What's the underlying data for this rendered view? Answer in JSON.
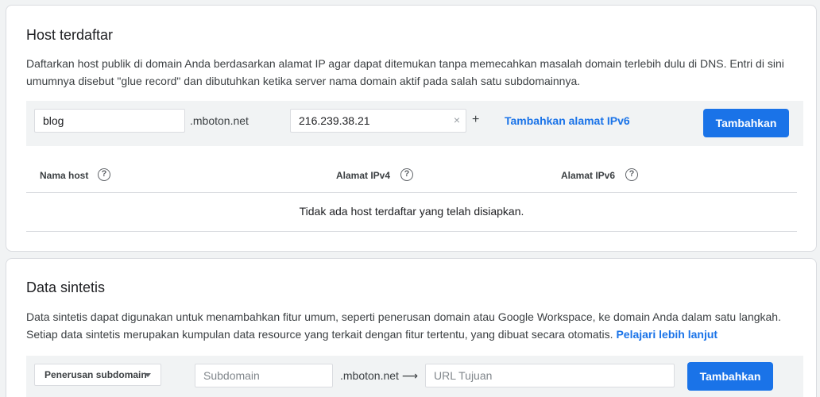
{
  "registered_hosts": {
    "title": "Host terdaftar",
    "description": "Daftarkan host publik di domain Anda berdasarkan alamat IP agar dapat ditemukan tanpa memecahkan masalah domain terlebih dulu di DNS. Entri di sini umumnya disebut \"glue record\" dan dibutuhkan ketika server nama domain aktif pada salah satu subdomainnya.",
    "host_input_value": "blog",
    "domain_suffix": ".mboton.net",
    "ipv4_input_value": "216.239.38.21",
    "clear_icon": "×",
    "plus": "+",
    "add_ipv6_link": "Tambahkan alamat IPv6",
    "add_button": "Tambahkan",
    "columns": [
      "Nama host",
      "Alamat IPv4",
      "Alamat IPv6"
    ],
    "help_icon": "?",
    "empty_message": "Tidak ada host terdaftar yang telah disiapkan."
  },
  "synthetic_records": {
    "title": "Data sintetis",
    "description": "Data sintetis dapat digunakan untuk menambahkan fitur umum, seperti penerusan domain atau Google Workspace, ke domain Anda dalam satu langkah. Setiap data sintetis merupakan kumpulan data resource yang terkait dengan fitur tertentu, yang dibuat secara otomatis.",
    "learn_more_link": "Pelajari lebih lanjut",
    "record_type_select": "Penerusan subdomain",
    "subdomain_placeholder": "Subdomain",
    "domain_suffix_arrow": ".mboton.net ⟶",
    "target_url_placeholder": "URL Tujuan",
    "add_button": "Tambahkan"
  },
  "colors": {
    "accent": "#1a73e8",
    "background": "#f1f3f4"
  }
}
